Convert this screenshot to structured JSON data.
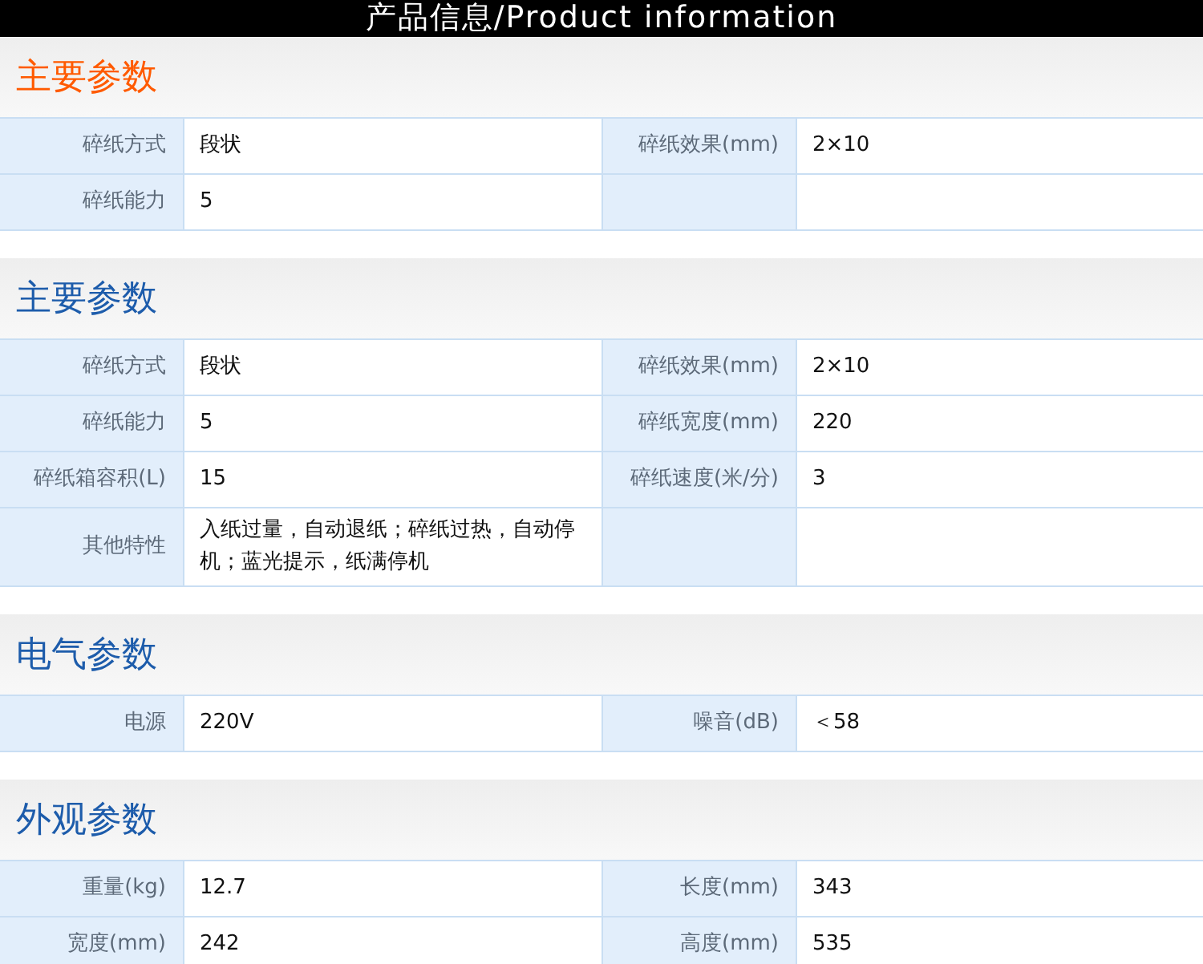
{
  "banner": {
    "title": "产品信息/Product information"
  },
  "sections": [
    {
      "title": "主要参数",
      "color": "#ff5a00",
      "rows": [
        {
          "pairs": [
            {
              "label": "碎纸方式",
              "value": "段状"
            },
            {
              "label": "碎纸效果(mm)",
              "value": "2×10"
            }
          ]
        },
        {
          "pairs": [
            {
              "label": "碎纸能力",
              "value": "5"
            }
          ]
        }
      ]
    },
    {
      "title": "主要参数",
      "color": "#1d5cab",
      "rows": [
        {
          "pairs": [
            {
              "label": "碎纸方式",
              "value": "段状"
            },
            {
              "label": "碎纸效果(mm)",
              "value": "2×10"
            }
          ]
        },
        {
          "pairs": [
            {
              "label": "碎纸能力",
              "value": "5"
            },
            {
              "label": "碎纸宽度(mm)",
              "value": "220"
            }
          ]
        },
        {
          "pairs": [
            {
              "label": "碎纸箱容积(L)",
              "value": "15"
            },
            {
              "label": "碎纸速度(米/分)",
              "value": "3"
            }
          ]
        },
        {
          "pairs": [
            {
              "label": "其他特性",
              "value": "入纸过量，自动退纸；碎纸过热，自动停机；蓝光提示，纸满停机"
            }
          ]
        }
      ]
    },
    {
      "title": "电气参数",
      "color": "#1d5cab",
      "rows": [
        {
          "pairs": [
            {
              "label": "电源",
              "value": "220V"
            },
            {
              "label": "噪音(dB)",
              "value": "＜58"
            }
          ]
        }
      ]
    },
    {
      "title": "外观参数",
      "color": "#1d5cab",
      "rows": [
        {
          "pairs": [
            {
              "label": "重量(kg)",
              "value": "12.7"
            },
            {
              "label": "长度(mm)",
              "value": "343"
            }
          ]
        },
        {
          "pairs": [
            {
              "label": "宽度(mm)",
              "value": "242"
            },
            {
              "label": "高度(mm)",
              "value": "535"
            }
          ]
        }
      ]
    }
  ]
}
